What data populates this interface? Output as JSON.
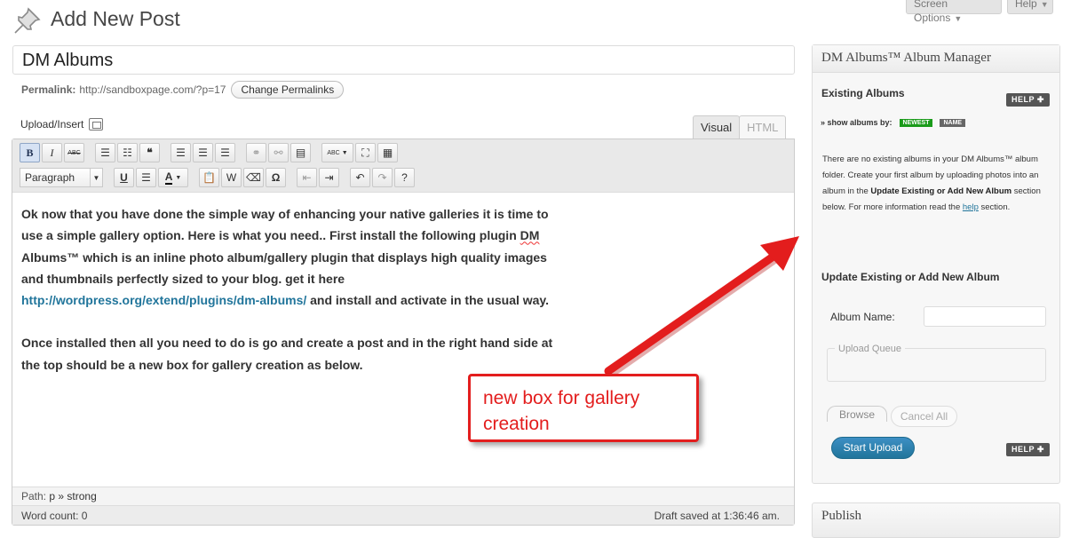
{
  "header": {
    "title": "Add New Post",
    "screen_options": "Screen Options",
    "help": "Help"
  },
  "post": {
    "title": "DM Albums",
    "permalink_label": "Permalink:",
    "permalink_url": "http://sandboxpage.com/?p=17",
    "change_permalinks": "Change Permalinks",
    "upload_insert": "Upload/Insert"
  },
  "editor": {
    "tab_visual": "Visual",
    "tab_html": "HTML",
    "format_value": "Paragraph",
    "content": {
      "p1_a": "Ok now that you have done the simple way of enhancing your native galleries it is time to use a simple gallery option. Here is what you need.. First install the following plugin ",
      "p1_b": "DM",
      "p1_c": " Albums™ which is an inline photo album/gallery plugin that displays high quality images and thumbnails perfectly sized to your blog. get it here ",
      "p1_link": "http://wordpress.org/extend/plugins/dm-albums/",
      "p1_d": " and install and activate in the usual way.",
      "p2": "Once installed then all you need to do is go and create a post and in the right hand side at the top should be a new box for gallery creation as below."
    },
    "path_label": "Path:",
    "path_value": "p » strong",
    "word_count": "Word count: 0",
    "draft_saved": "Draft saved at 1:36:46 am."
  },
  "annotation": {
    "text": "new box for gallery creation",
    "color": "#e31d1d"
  },
  "album_manager": {
    "title": "DM Albums™ Album Manager",
    "existing_heading": "Existing Albums",
    "help": "HELP",
    "show_albums_by": "» show albums by:",
    "tag_newest": "NEWEST",
    "tag_name": "NAME",
    "info_1": "There are no existing albums in your DM Albums™ album folder. Create your first album by uploading photos into an album in the ",
    "info_bold": "Update Existing or Add New Album",
    "info_2": " section below. For more information read the ",
    "info_link": "help",
    "info_3": " section.",
    "update_heading": "Update Existing or Add New Album",
    "album_name_label": "Album Name:",
    "album_name_value": "",
    "upload_queue": "Upload Queue",
    "browse": "Browse",
    "cancel_all": "Cancel All",
    "start_upload": "Start Upload"
  },
  "publish": {
    "title": "Publish"
  }
}
